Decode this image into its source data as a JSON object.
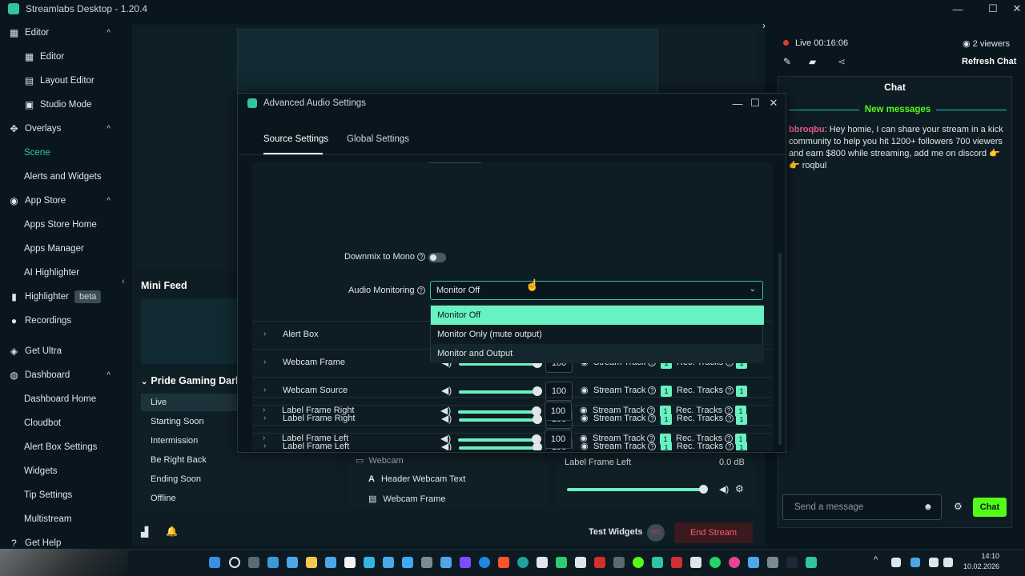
{
  "app": {
    "title": "Streamlabs Desktop - 1.20.4",
    "window_controls": {
      "minimize": "—",
      "maximize": "☐",
      "close": "✕"
    }
  },
  "sidebar": {
    "items": [
      {
        "label": "Editor",
        "icon": "editor-icon",
        "expand": "^"
      },
      {
        "label": "Editor",
        "icon": "editor-sub-icon"
      },
      {
        "label": "Layout Editor",
        "icon": "layout-icon"
      },
      {
        "label": "Studio Mode",
        "icon": "studio-icon"
      },
      {
        "label": "Overlays",
        "icon": "overlays-icon",
        "expand": "^"
      },
      {
        "label": "Scene",
        "active": true
      },
      {
        "label": "Alerts and Widgets"
      },
      {
        "label": "App Store",
        "icon": "app-store-icon",
        "expand": "^"
      },
      {
        "label": "Apps Store Home"
      },
      {
        "label": "Apps Manager"
      },
      {
        "label": "AI Highlighter"
      },
      {
        "label": "Highlighter",
        "icon": "highlighter-icon",
        "badge": "beta"
      },
      {
        "label": "Recordings",
        "icon": "recordings-icon"
      },
      {
        "label": "Get Ultra",
        "icon": "ultra-icon"
      },
      {
        "label": "Dashboard",
        "icon": "dashboard-icon",
        "expand": "^"
      },
      {
        "label": "Dashboard Home"
      },
      {
        "label": "Cloudbot"
      },
      {
        "label": "Alert Box Settings"
      },
      {
        "label": "Widgets"
      },
      {
        "label": "Tip Settings"
      },
      {
        "label": "Multistream"
      },
      {
        "label": "Get Help",
        "icon": "help-icon"
      }
    ]
  },
  "editor": {
    "mini_feed_title": "Mini Feed",
    "scene_collection_title": "Pride Gaming Dark",
    "scenes": [
      "Live",
      "Starting Soon",
      "Intermission",
      "Be Right Back",
      "Ending Soon",
      "Offline"
    ],
    "sources": {
      "group": "Webcam",
      "items": [
        "Header Webcam Text",
        "Webcam Frame"
      ]
    },
    "mixer": {
      "name": "Label Frame Left",
      "value": "0.0 dB"
    },
    "bottom": {
      "test_widgets": "Test Widgets",
      "rec": "REC",
      "end_stream": "End Stream"
    }
  },
  "chat_panel": {
    "live_label": "Live",
    "live_time": "00:16:06",
    "viewers": "2 viewers",
    "refresh": "Refresh Chat",
    "header": "Chat",
    "new_messages": "New messages",
    "message_user": "bbroqbu",
    "message_text": ": Hey homie, I can share your stream in a kick community to help you hit 1200+ followers 700 viewers and earn $800 while streaming, add me on discord 👉 👉 roqbul",
    "input_placeholder": "Send a message",
    "send": "Chat"
  },
  "dialog": {
    "title": "Advanced Audio Settings",
    "tabs": [
      "Source Settings",
      "Global Settings"
    ],
    "downmix_label": "Downmix to Mono",
    "audio_monitoring_label": "Audio Monitoring",
    "audio_monitoring_value": "Monitor Off",
    "options": [
      "Monitor Off",
      "Monitor Only (mute output)",
      "Monitor and Output"
    ],
    "sources": [
      {
        "name": "Alert Box"
      },
      {
        "name": "Webcam Frame",
        "volume": "100",
        "stream_track": "Stream Track",
        "stream_track_num": "1",
        "rec_tracks": "Rec. Tracks",
        "rec_tracks_num": "1"
      },
      {
        "name": "Webcam Source",
        "volume": "100",
        "stream_track": "Stream Track",
        "stream_track_num": "1",
        "rec_tracks": "Rec. Tracks",
        "rec_tracks_num": "1"
      },
      {
        "name": "Label Frame Right",
        "volume": "100",
        "stream_track": "Stream Track",
        "stream_track_num": "1",
        "rec_tracks": "Rec. Tracks",
        "rec_tracks_num": "1"
      },
      {
        "name": "Label Frame Left",
        "volume": "100",
        "stream_track": "Stream Track",
        "stream_track_num": "1",
        "rec_tracks": "Rec. Tracks",
        "rec_tracks_num": "1"
      },
      {
        "name": "Label Frame Right",
        "volume": "100",
        "stream_track": "Stream Track",
        "stream_track_num": "1",
        "rec_tracks": "Rec. Tracks",
        "rec_tracks_num": "1"
      },
      {
        "name": "Label Frame Left",
        "volume": "100",
        "stream_track": "Stream Track",
        "stream_track_num": "1",
        "rec_tracks": "Rec. Tracks",
        "rec_tracks_num": "1"
      }
    ]
  },
  "taskbar": {
    "time": "14:10",
    "date": "10.02.2026"
  },
  "colors": {
    "accent": "#31c3a2",
    "mint": "#69f2c1",
    "kick_green": "#53fc18",
    "live_red": "#e53935",
    "bg": "#09161d"
  }
}
